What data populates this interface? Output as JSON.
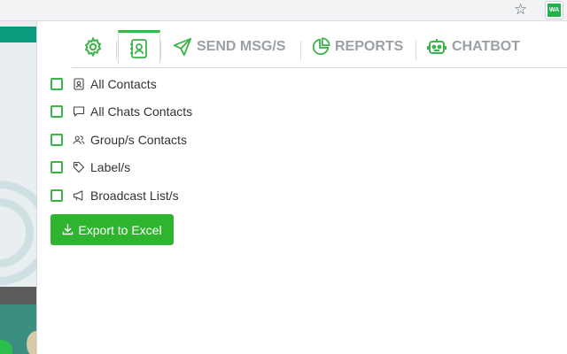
{
  "browser": {
    "star_icon": "star-icon",
    "extension_badge": "WA"
  },
  "tabs": [
    {
      "id": "settings",
      "label": "",
      "icon": "gear-icon"
    },
    {
      "id": "contacts",
      "label": "",
      "icon": "contact-book-icon",
      "active": true
    },
    {
      "id": "send",
      "label": "SEND MSG/S",
      "icon": "send-icon"
    },
    {
      "id": "reports",
      "label": "REPORTS",
      "icon": "pie-chart-icon"
    },
    {
      "id": "chatbot",
      "label": "CHATBOT",
      "icon": "robot-icon"
    }
  ],
  "options": [
    {
      "label": "All Contacts",
      "icon": "contact-card-icon",
      "checked": false
    },
    {
      "label": "All Chats Contacts",
      "icon": "chat-bubble-icon",
      "checked": false
    },
    {
      "label": "Group/s Contacts",
      "icon": "users-icon",
      "checked": false
    },
    {
      "label": "Label/s",
      "icon": "tag-icon",
      "checked": false
    },
    {
      "label": "Broadcast List/s",
      "icon": "megaphone-icon",
      "checked": false
    }
  ],
  "export": {
    "label": "Export to Excel",
    "icon": "download-icon"
  },
  "colors": {
    "accent": "#3ab54a",
    "button": "#2fb42f",
    "tab_text": "#9aa0a6"
  }
}
